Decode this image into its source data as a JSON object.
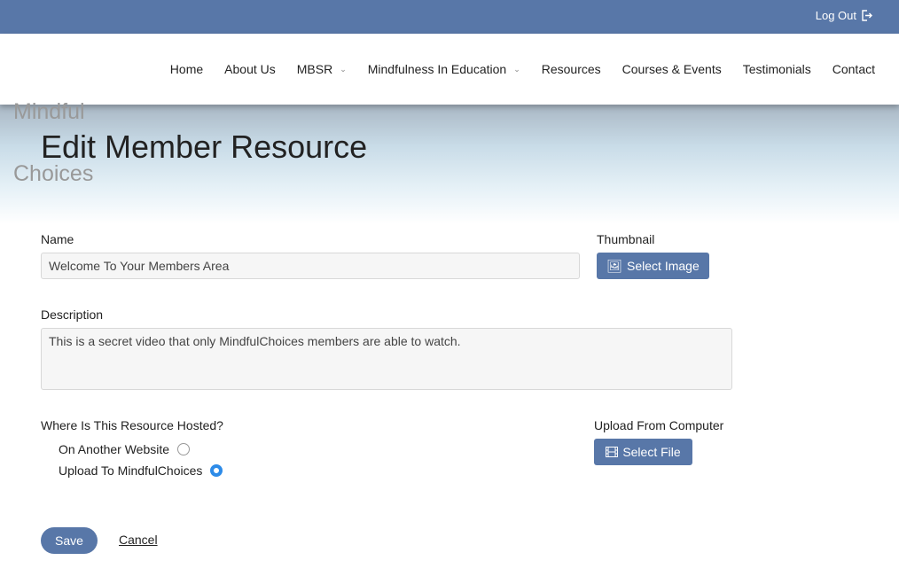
{
  "topbar": {
    "logout_label": "Log Out",
    "logout_icon": "sign-out-icon"
  },
  "nav": {
    "items": [
      {
        "label": "Home"
      },
      {
        "label": "About Us"
      },
      {
        "label": "MBSR",
        "dropdown": true
      },
      {
        "label": "Mindfulness In Education",
        "dropdown": true
      },
      {
        "label": "Resources"
      },
      {
        "label": "Courses & Events"
      },
      {
        "label": "Testimonials"
      },
      {
        "label": "Contact"
      }
    ],
    "chevron": "⌄"
  },
  "logo": {
    "line1": "Mindful",
    "line2": "Choices"
  },
  "page": {
    "title": "Edit Member Resource"
  },
  "form": {
    "name_label": "Name",
    "name_value": "Welcome To Your Members Area",
    "thumbnail_label": "Thumbnail",
    "select_image_label": "Select Image",
    "description_label": "Description",
    "description_value": "This is a secret video that only MindfulChoices members are able to watch.",
    "hosted_label": "Where Is This Resource Hosted?",
    "hosted_options": [
      {
        "label": "On Another Website",
        "selected": false
      },
      {
        "label": "Upload To MindfulChoices",
        "selected": true
      }
    ],
    "upload_label": "Upload From Computer",
    "select_file_label": "Select File",
    "save_label": "Save",
    "cancel_label": "Cancel"
  },
  "colors": {
    "brand": "#5877a8",
    "radio_selected": "#2d8be8"
  }
}
